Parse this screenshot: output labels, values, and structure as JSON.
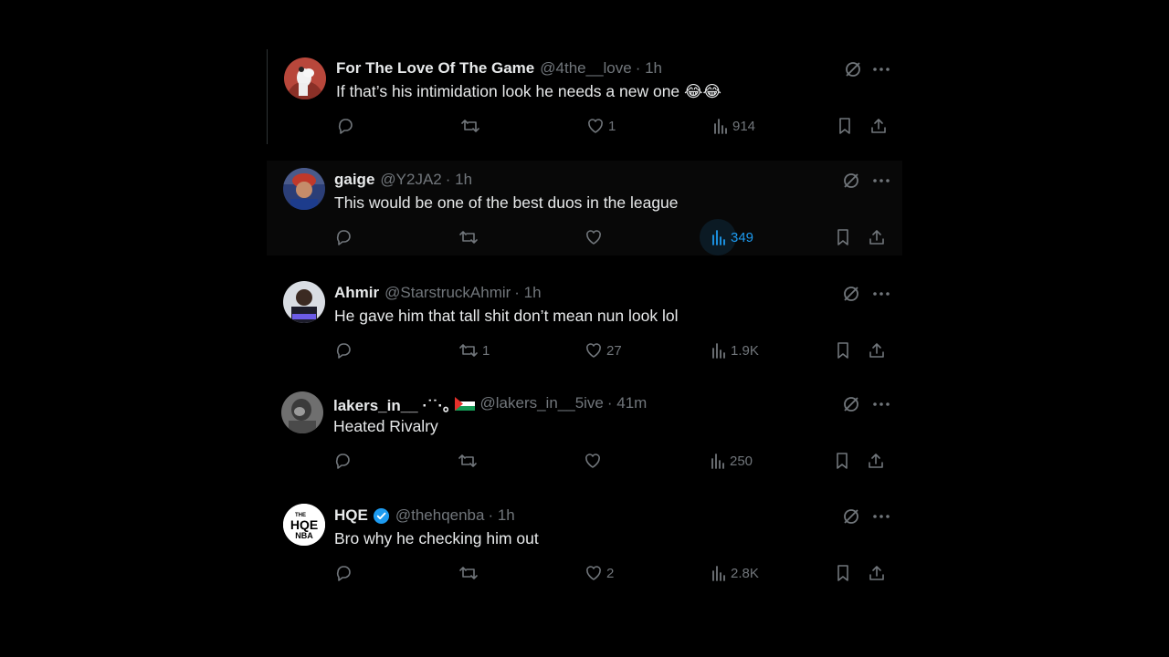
{
  "colors": {
    "background": "#000000",
    "text": "#e7e9ea",
    "muted": "#71767b",
    "accent": "#1d9bf0"
  },
  "tweets": [
    {
      "name": "For The Love Of The Game",
      "handle": "@4the__love",
      "time": "· 1h",
      "text": "If that’s his intimidation look he needs a new one 😂😂",
      "replies": "",
      "retweets": "",
      "likes": "1",
      "views": "914"
    },
    {
      "name": "gaige",
      "handle": "@Y2JA2",
      "time": "· 1h",
      "text": "This would be one of the best duos in the league",
      "replies": "",
      "retweets": "",
      "likes": "",
      "views": "349"
    },
    {
      "name": "Ahmir",
      "handle": "@StarstruckAhmir",
      "time": "· 1h",
      "text": "He gave him that tall shit don’t mean nun look lol",
      "replies": "",
      "retweets": "1",
      "likes": "27",
      "views": "1.9K"
    },
    {
      "name": "lakers_in__ ·˙˙·｡",
      "handle": "@lakers_in__5ive",
      "time": "· 41m",
      "text": "Heated Rivalry",
      "replies": "",
      "retweets": "",
      "likes": "",
      "views": "250"
    },
    {
      "name": "HQE",
      "handle": "@thehqenba",
      "time": "· 1h",
      "text": "Bro why he checking him out",
      "replies": "",
      "retweets": "",
      "likes": "2",
      "views": "2.8K",
      "avatar_text": {
        "line1": "THE",
        "line2": "HQE",
        "line3": "NBA"
      }
    }
  ]
}
